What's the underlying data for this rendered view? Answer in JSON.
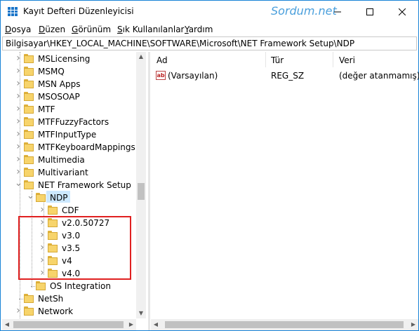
{
  "window": {
    "title": "Kayıt Defteri Düzenleyicisi",
    "watermark": "Sordum.net",
    "accent": "#1883d7"
  },
  "menu": [
    {
      "first": "D",
      "rest": "osya"
    },
    {
      "first": "D",
      "rest": "üzen"
    },
    {
      "first": "G",
      "rest": "örünüm"
    },
    {
      "first": "S",
      "rest": "ık Kullanılanlar"
    },
    {
      "first": "Y",
      "rest": "ardım"
    }
  ],
  "address": "Bilgisayar\\HKEY_LOCAL_MACHINE\\SOFTWARE\\Microsoft\\NET Framework Setup\\NDP",
  "tree": {
    "items": [
      {
        "label": "MSLicensing",
        "expander": "collapsed"
      },
      {
        "label": "MSMQ",
        "expander": "collapsed"
      },
      {
        "label": "MSN Apps",
        "expander": "collapsed"
      },
      {
        "label": "MSOSOAP",
        "expander": "collapsed"
      },
      {
        "label": "MTF",
        "expander": "collapsed"
      },
      {
        "label": "MTFFuzzyFactors",
        "expander": "collapsed"
      },
      {
        "label": "MTFInputType",
        "expander": "collapsed"
      },
      {
        "label": "MTFKeyboardMappings",
        "expander": "collapsed"
      },
      {
        "label": "Multimedia",
        "expander": "collapsed"
      },
      {
        "label": "Multivariant",
        "expander": "collapsed"
      },
      {
        "label": "NET Framework Setup",
        "expander": "expanded"
      },
      {
        "label": "NDP",
        "expander": "expanded",
        "selected": true
      },
      {
        "label": "CDF",
        "expander": "collapsed"
      },
      {
        "label": "v2.0.50727",
        "expander": "collapsed"
      },
      {
        "label": "v3.0",
        "expander": "collapsed"
      },
      {
        "label": "v3.5",
        "expander": "collapsed"
      },
      {
        "label": "v4",
        "expander": "collapsed"
      },
      {
        "label": "v4.0",
        "expander": "collapsed"
      },
      {
        "label": "OS Integration",
        "expander": "none"
      },
      {
        "label": "NetSh",
        "expander": "none"
      },
      {
        "label": "Network",
        "expander": "collapsed"
      }
    ]
  },
  "list": {
    "columns": [
      "Ad",
      "Tür",
      "Veri"
    ],
    "rows": [
      {
        "name": "(Varsayılan)",
        "type": "REG_SZ",
        "data": "(değer atanmamış)"
      }
    ]
  },
  "highlight_color": "#e02020"
}
